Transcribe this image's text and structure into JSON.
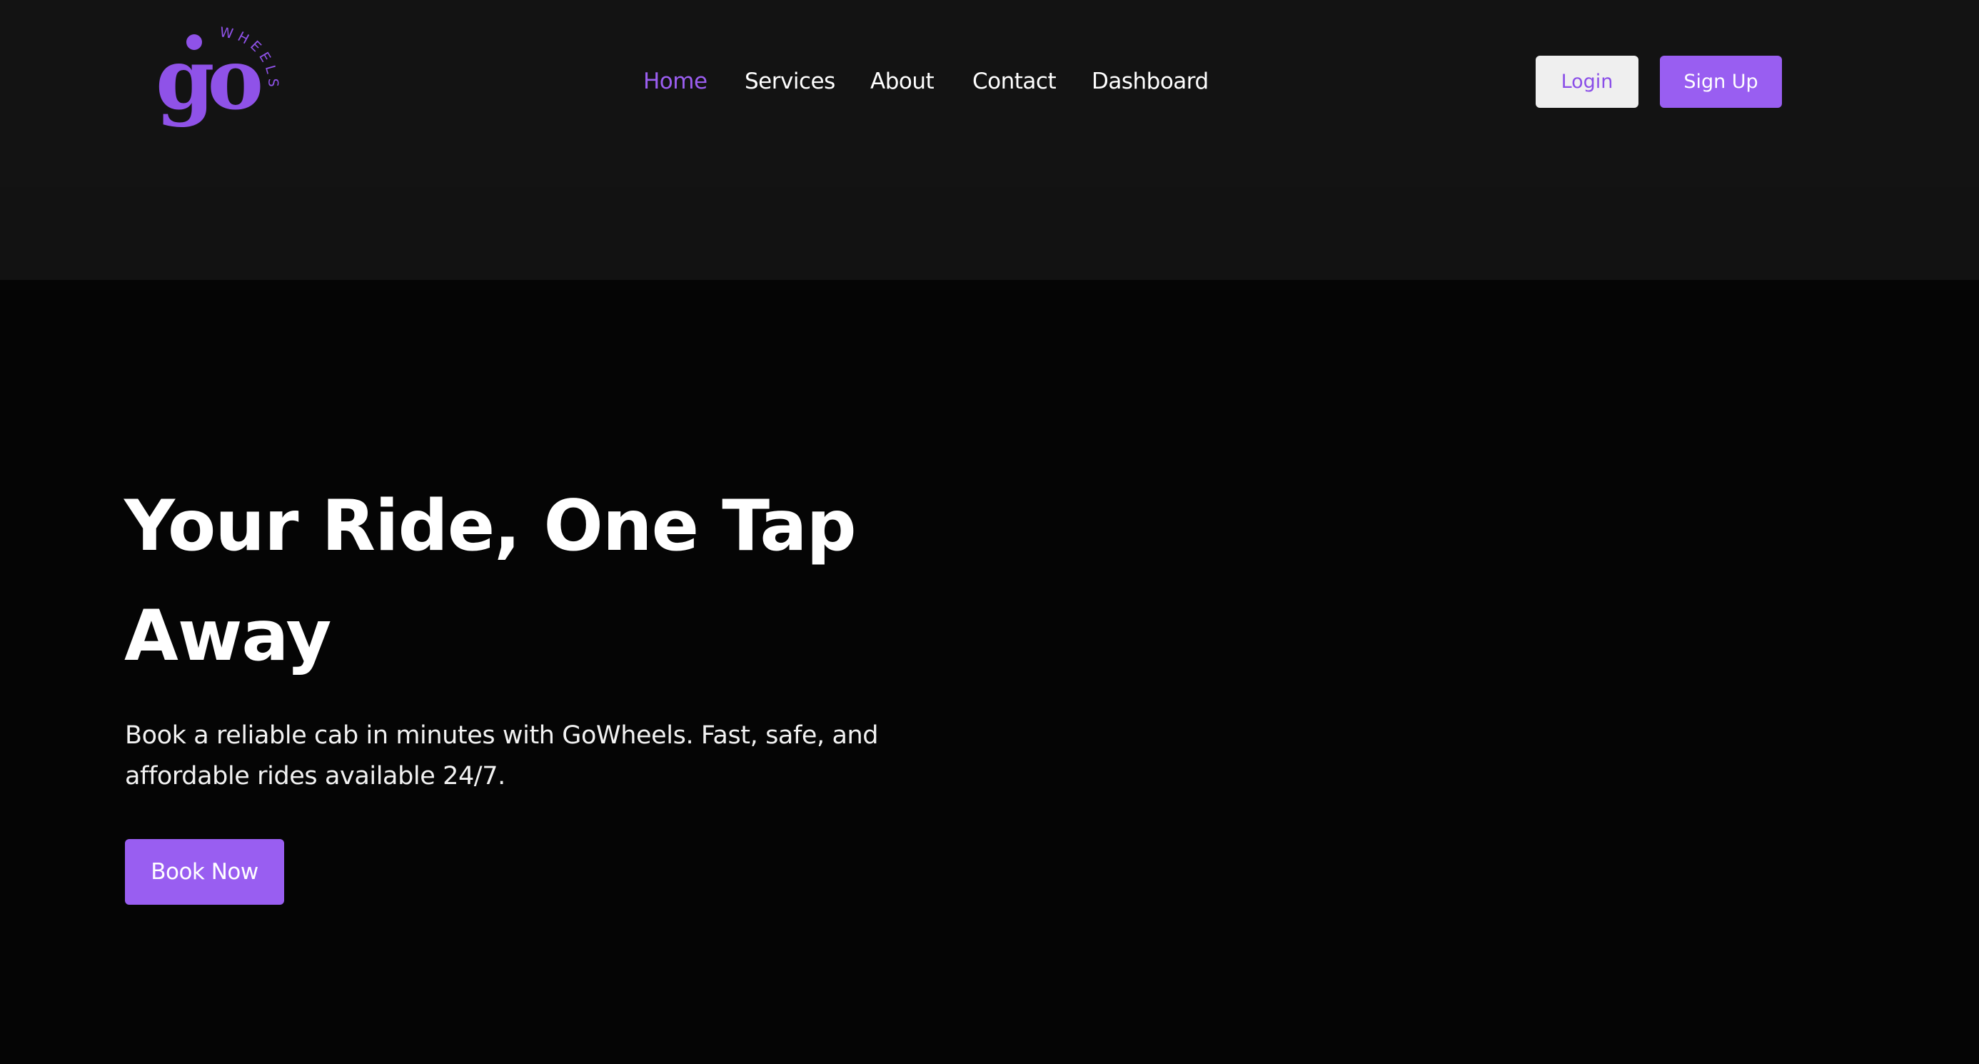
{
  "brand": {
    "logo_main": "go",
    "logo_sub": "WHEELS",
    "accent_color": "#995ef1"
  },
  "nav": {
    "items": [
      {
        "label": "Home",
        "active": true
      },
      {
        "label": "Services",
        "active": false
      },
      {
        "label": "About",
        "active": false
      },
      {
        "label": "Contact",
        "active": false
      },
      {
        "label": "Dashboard",
        "active": false
      }
    ]
  },
  "auth": {
    "login_label": "Login",
    "signup_label": "Sign Up"
  },
  "hero": {
    "title": "Your Ride, One Tap Away",
    "subtitle": "Book a reliable cab in minutes with GoWheels. Fast, safe, and affordable rides available 24/7.",
    "cta_label": "Book Now"
  }
}
